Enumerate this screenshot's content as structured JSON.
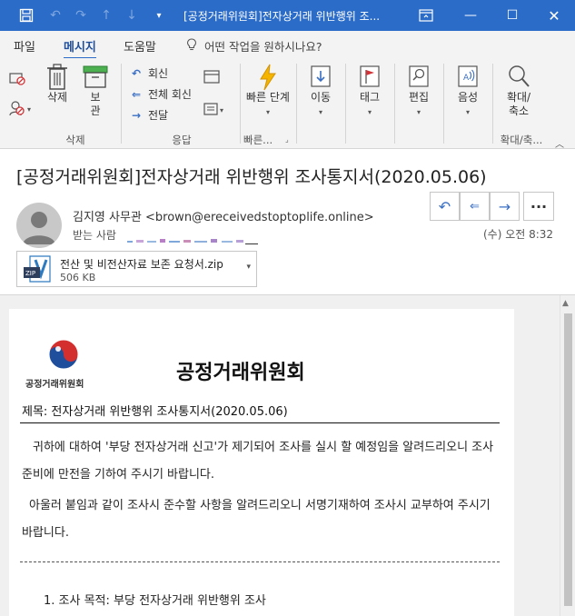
{
  "window": {
    "title": "[공정거래위원회]전자상거래 위반행위 조...",
    "colors": {
      "titlebar": "#2b6cc8",
      "accent": "#3a6fc4"
    }
  },
  "menu": {
    "tabs": [
      "파일",
      "메시지",
      "도움말"
    ],
    "active_tab": "메시지",
    "tell_me": "어떤 작업을 원하시나요?"
  },
  "ribbon": {
    "delete": {
      "delete_label": "삭제",
      "archive_label": "보관",
      "group_label": "삭제"
    },
    "respond": {
      "reply": "회신",
      "reply_all": "전체 회신",
      "forward": "전달",
      "group_label": "응답"
    },
    "quick_steps": {
      "label": "빠른 단계",
      "group_label": "빠른..."
    },
    "move_label": "이동",
    "tags_label": "태그",
    "editing_label": "편집",
    "speech_label": "음성",
    "zoom": {
      "label": "확대/축소",
      "group_label": "확대/축..."
    }
  },
  "message": {
    "subject": "[공정거래위원회]전자상거래 위반행위 조사통지서(2020.05.06)",
    "sender": "김지영 사무관 <brown@ereceivedstoptoplife.online>",
    "to_label": "받는 사람",
    "date": "(수) 오전 8:32",
    "attachment": {
      "name": "전산 및 비전산자료 보존 요청서.zip",
      "size": "506 KB",
      "badge": "ZIP"
    }
  },
  "document": {
    "logo_text": "공정거래위원회",
    "org_title": "공정거래위원회",
    "subject_line": "제목: 전자상거래 위반행위 조사통지서(2020.05.06)",
    "paragraph1": "귀하에 대하여 '부당 전자상거래 신고'가 제기되어 조사를 실시 할 예정임을 알려드리오니 조사준비에 만전을 기하여 주시기 바랍니다.",
    "paragraph2": "아울러 붙임과 같이 조사시 준수할 사항을 알려드리오니 서명기재하여 조사시 교부하여 주시기바랍니다.",
    "item1": "1.  조사 목적: 부당 전자상거래 위반행위 조사"
  }
}
